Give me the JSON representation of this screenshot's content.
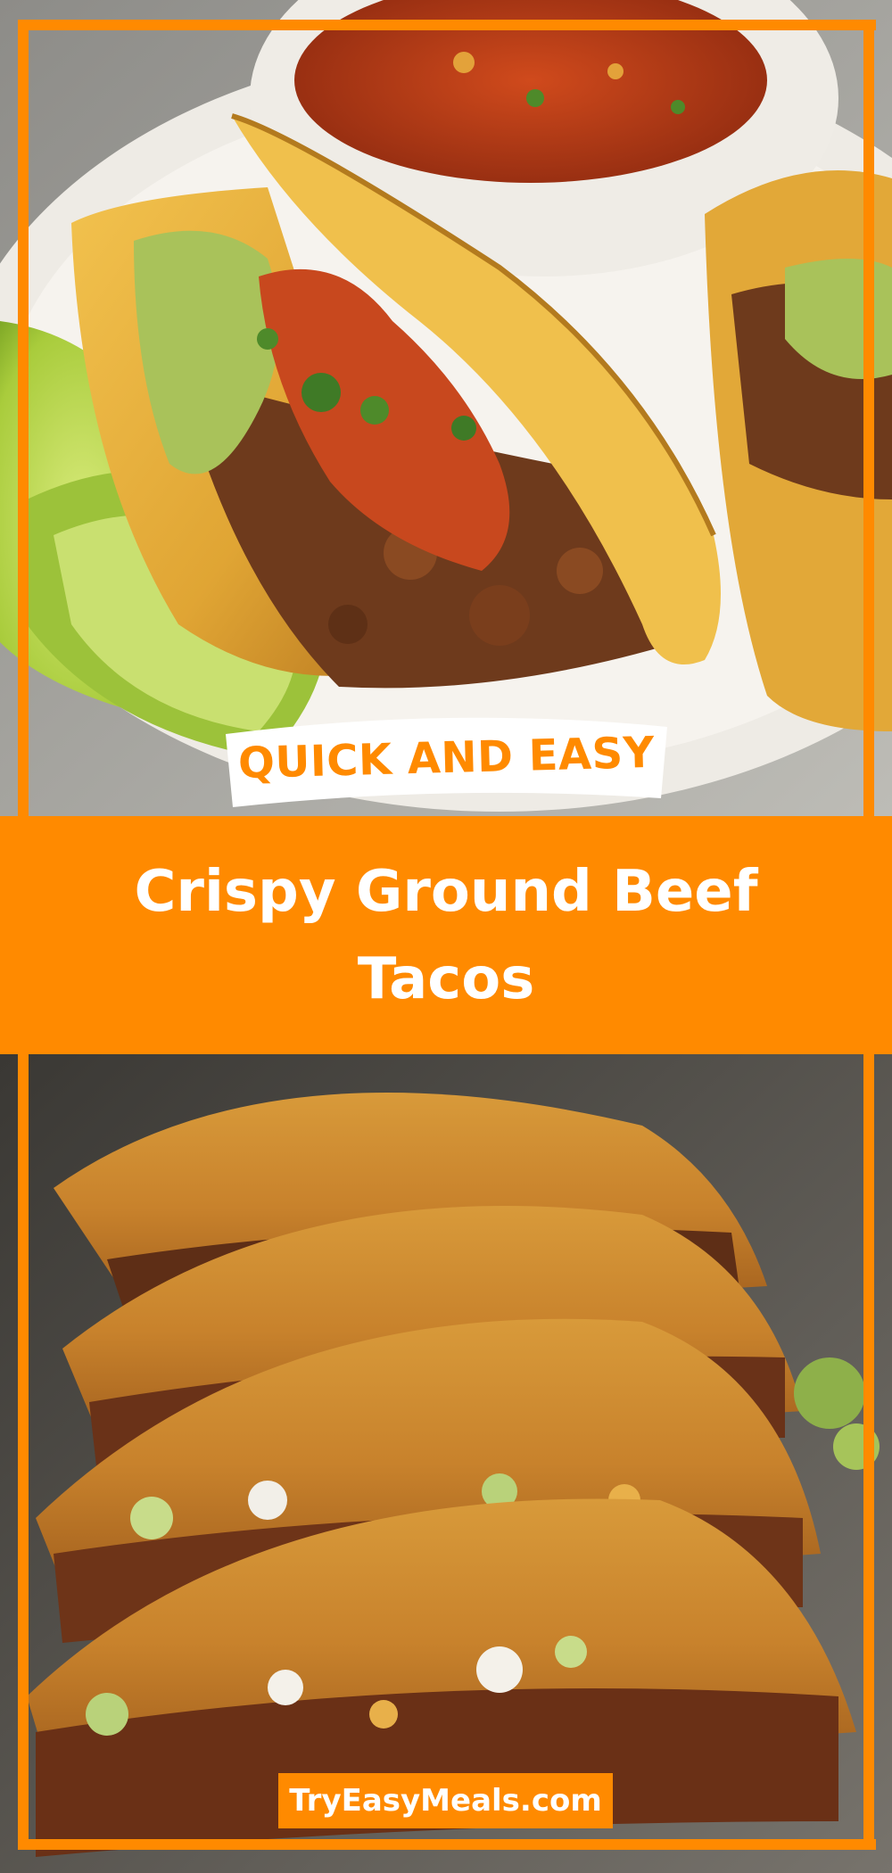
{
  "badge": {
    "label": "QUICK AND EASY"
  },
  "title": {
    "text": "Crispy Ground Beef Tacos"
  },
  "site": {
    "label": "TryEasyMeals.com"
  },
  "colors": {
    "accent": "#ff8a00",
    "text_on_accent": "#ffffff",
    "badge_bg": "#ffffff"
  },
  "images": {
    "top": "photo of crispy taco with guacamole, salsa and cilantro beside lime wedges and a bowl of salsa",
    "bottom": "photo of a row of crispy ground beef tacos topped with lettuce, cheese and sour cream"
  }
}
